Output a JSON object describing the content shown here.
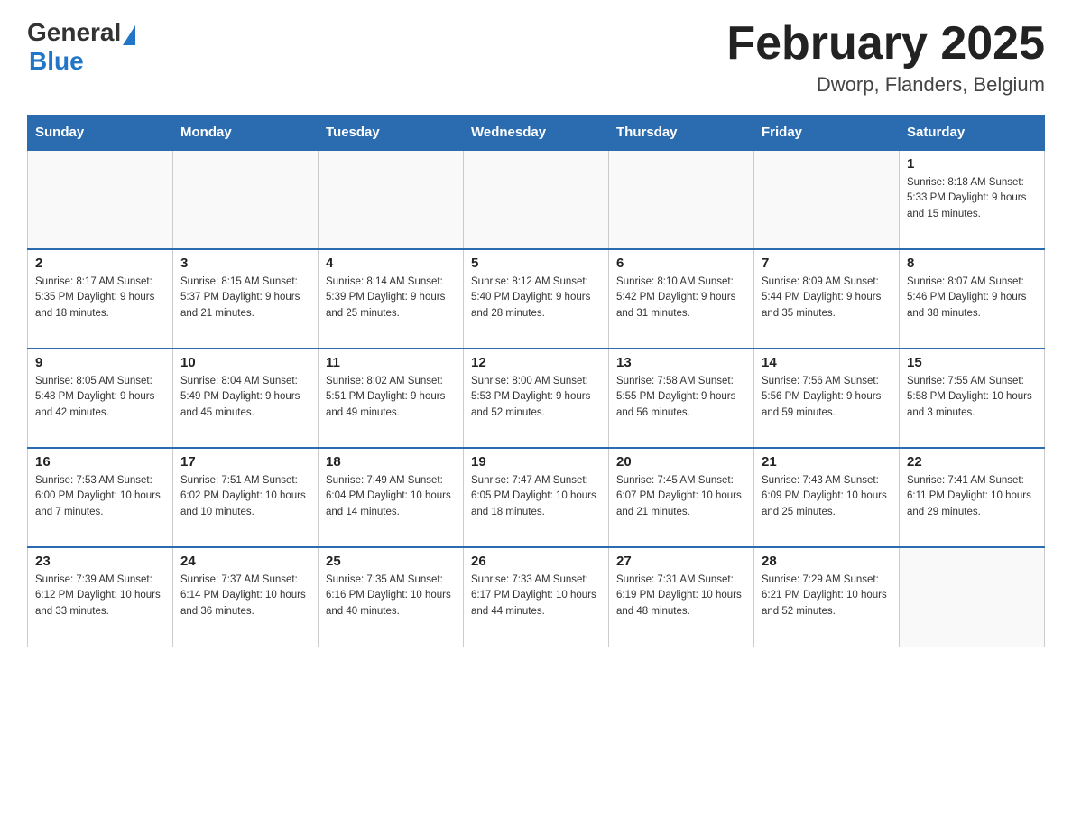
{
  "header": {
    "logo_general": "General",
    "logo_blue": "Blue",
    "month_title": "February 2025",
    "location": "Dworp, Flanders, Belgium"
  },
  "weekdays": [
    "Sunday",
    "Monday",
    "Tuesday",
    "Wednesday",
    "Thursday",
    "Friday",
    "Saturday"
  ],
  "weeks": [
    [
      {
        "day": "",
        "info": ""
      },
      {
        "day": "",
        "info": ""
      },
      {
        "day": "",
        "info": ""
      },
      {
        "day": "",
        "info": ""
      },
      {
        "day": "",
        "info": ""
      },
      {
        "day": "",
        "info": ""
      },
      {
        "day": "1",
        "info": "Sunrise: 8:18 AM\nSunset: 5:33 PM\nDaylight: 9 hours and 15 minutes."
      }
    ],
    [
      {
        "day": "2",
        "info": "Sunrise: 8:17 AM\nSunset: 5:35 PM\nDaylight: 9 hours and 18 minutes."
      },
      {
        "day": "3",
        "info": "Sunrise: 8:15 AM\nSunset: 5:37 PM\nDaylight: 9 hours and 21 minutes."
      },
      {
        "day": "4",
        "info": "Sunrise: 8:14 AM\nSunset: 5:39 PM\nDaylight: 9 hours and 25 minutes."
      },
      {
        "day": "5",
        "info": "Sunrise: 8:12 AM\nSunset: 5:40 PM\nDaylight: 9 hours and 28 minutes."
      },
      {
        "day": "6",
        "info": "Sunrise: 8:10 AM\nSunset: 5:42 PM\nDaylight: 9 hours and 31 minutes."
      },
      {
        "day": "7",
        "info": "Sunrise: 8:09 AM\nSunset: 5:44 PM\nDaylight: 9 hours and 35 minutes."
      },
      {
        "day": "8",
        "info": "Sunrise: 8:07 AM\nSunset: 5:46 PM\nDaylight: 9 hours and 38 minutes."
      }
    ],
    [
      {
        "day": "9",
        "info": "Sunrise: 8:05 AM\nSunset: 5:48 PM\nDaylight: 9 hours and 42 minutes."
      },
      {
        "day": "10",
        "info": "Sunrise: 8:04 AM\nSunset: 5:49 PM\nDaylight: 9 hours and 45 minutes."
      },
      {
        "day": "11",
        "info": "Sunrise: 8:02 AM\nSunset: 5:51 PM\nDaylight: 9 hours and 49 minutes."
      },
      {
        "day": "12",
        "info": "Sunrise: 8:00 AM\nSunset: 5:53 PM\nDaylight: 9 hours and 52 minutes."
      },
      {
        "day": "13",
        "info": "Sunrise: 7:58 AM\nSunset: 5:55 PM\nDaylight: 9 hours and 56 minutes."
      },
      {
        "day": "14",
        "info": "Sunrise: 7:56 AM\nSunset: 5:56 PM\nDaylight: 9 hours and 59 minutes."
      },
      {
        "day": "15",
        "info": "Sunrise: 7:55 AM\nSunset: 5:58 PM\nDaylight: 10 hours and 3 minutes."
      }
    ],
    [
      {
        "day": "16",
        "info": "Sunrise: 7:53 AM\nSunset: 6:00 PM\nDaylight: 10 hours and 7 minutes."
      },
      {
        "day": "17",
        "info": "Sunrise: 7:51 AM\nSunset: 6:02 PM\nDaylight: 10 hours and 10 minutes."
      },
      {
        "day": "18",
        "info": "Sunrise: 7:49 AM\nSunset: 6:04 PM\nDaylight: 10 hours and 14 minutes."
      },
      {
        "day": "19",
        "info": "Sunrise: 7:47 AM\nSunset: 6:05 PM\nDaylight: 10 hours and 18 minutes."
      },
      {
        "day": "20",
        "info": "Sunrise: 7:45 AM\nSunset: 6:07 PM\nDaylight: 10 hours and 21 minutes."
      },
      {
        "day": "21",
        "info": "Sunrise: 7:43 AM\nSunset: 6:09 PM\nDaylight: 10 hours and 25 minutes."
      },
      {
        "day": "22",
        "info": "Sunrise: 7:41 AM\nSunset: 6:11 PM\nDaylight: 10 hours and 29 minutes."
      }
    ],
    [
      {
        "day": "23",
        "info": "Sunrise: 7:39 AM\nSunset: 6:12 PM\nDaylight: 10 hours and 33 minutes."
      },
      {
        "day": "24",
        "info": "Sunrise: 7:37 AM\nSunset: 6:14 PM\nDaylight: 10 hours and 36 minutes."
      },
      {
        "day": "25",
        "info": "Sunrise: 7:35 AM\nSunset: 6:16 PM\nDaylight: 10 hours and 40 minutes."
      },
      {
        "day": "26",
        "info": "Sunrise: 7:33 AM\nSunset: 6:17 PM\nDaylight: 10 hours and 44 minutes."
      },
      {
        "day": "27",
        "info": "Sunrise: 7:31 AM\nSunset: 6:19 PM\nDaylight: 10 hours and 48 minutes."
      },
      {
        "day": "28",
        "info": "Sunrise: 7:29 AM\nSunset: 6:21 PM\nDaylight: 10 hours and 52 minutes."
      },
      {
        "day": "",
        "info": ""
      }
    ]
  ]
}
